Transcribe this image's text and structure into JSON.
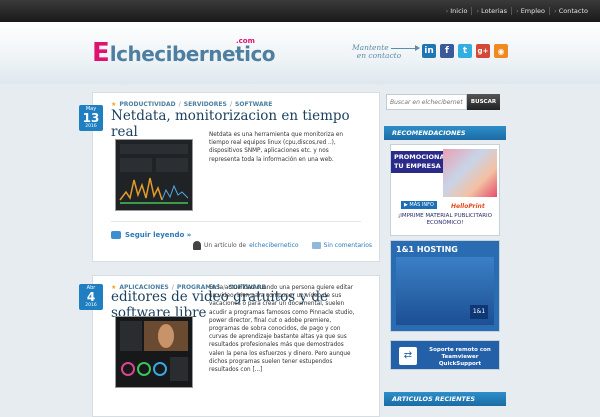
{
  "topnav": [
    "Inicio",
    "Loterias",
    "Empleo",
    "Contacto"
  ],
  "logo": {
    "first": "E",
    "rest": "lchecibernetico",
    "suffix": ".com"
  },
  "follow": {
    "line1": "Mantente",
    "line2": "en contacto"
  },
  "social": [
    {
      "icon": "linkedin-icon",
      "glyph": "in",
      "color": "#1e77b3"
    },
    {
      "icon": "facebook-icon",
      "glyph": "f",
      "color": "#3b5a9a"
    },
    {
      "icon": "twitter-icon",
      "glyph": "t",
      "color": "#33aee0"
    },
    {
      "icon": "googleplus-icon",
      "glyph": "g+",
      "color": "#d34836"
    },
    {
      "icon": "rss-icon",
      "glyph": "◉",
      "color": "#f0891f"
    }
  ],
  "posts": [
    {
      "categories": [
        "PRODUCTIVIDAD",
        "SERVIDORES",
        "SOFTWARE"
      ],
      "date": {
        "month": "May",
        "day": "13",
        "year": "2016"
      },
      "title": "Netdata, monitorizacion en tiempo real",
      "excerpt": "Netdata es una herramienta que monitoriza en tiempo real equipos linux (cpu,discos,red ..), dispositivos SNMP, aplicaciones etc. y nos representa toda la información en una web.",
      "read_more": "Seguir leyendo »",
      "author_prefix": "Un artículo de",
      "author": "elchecibernetico",
      "comments": "Sin comentarios"
    },
    {
      "categories": [
        "APLICACIONES",
        "PROGRAMAS",
        "SOFTWARE"
      ],
      "date": {
        "month": "Abr",
        "day": "4",
        "year": "2016"
      },
      "title": "editores de video gratuitos y de software libre",
      "excerpt": "En la actualidad cuando una persona quiere editar un vídeo, bien para componer un vídeo de sus vacaciones o para crear un documental, suelen acudir a programas famosos como Pinnacle studio, power director, final cut o adobe premiere, programas de sobra conocidos, de pago y con curvas de aprendizaje bastante altas ya que sus resultados profesionales más que demostrados valen la pena los esfuerzos y dinero. Pero aunque dichos programas suelen tener estupendos resultados con [...]"
    }
  ],
  "search": {
    "placeholder": "Buscar en elchecibernetico",
    "button": "BUSCAR"
  },
  "widgets": {
    "recommendations": "RECOMENDACIONES",
    "recent": "ARTICULOS RECIENTES"
  },
  "ads": {
    "promo_head": "PROMOCIONA TU EMPRESA",
    "promo_more": "▶ MÁS INFO",
    "hello": "HelloPrint",
    "promo_note": "¡IMPRIME MATERIAL PUBLICITARIO ECONÓMICO!",
    "hosting": "1&1 HOSTING",
    "hosting_logo": "1&1",
    "teamviewer": "Soporte remoto con Teamviewer QuickSupport"
  }
}
